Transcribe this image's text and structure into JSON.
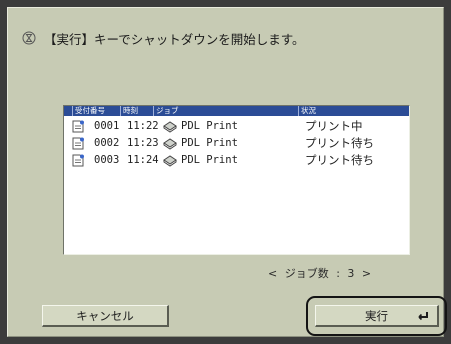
{
  "message": {
    "icon": "hourglass-icon",
    "text": "【実行】キーでシャットダウンを開始します。"
  },
  "table": {
    "headers": [
      "受付番号",
      "時刻",
      "ジョブ",
      "状況"
    ],
    "rows": [
      {
        "number": "0001",
        "time": "11:22",
        "job": "PDL Print",
        "status": "プリント中"
      },
      {
        "number": "0002",
        "time": "11:23",
        "job": "PDL Print",
        "status": "プリント待ち"
      },
      {
        "number": "0003",
        "time": "11:24",
        "job": "PDL Print",
        "status": "プリント待ち"
      }
    ]
  },
  "job_count": "< ジョブ数 : 3 >",
  "buttons": {
    "cancel": "キャンセル",
    "execute": "実行"
  },
  "colors": {
    "panel": "#c7cbb4",
    "header": "#2b4c96",
    "frame": "#3c3c3c"
  }
}
